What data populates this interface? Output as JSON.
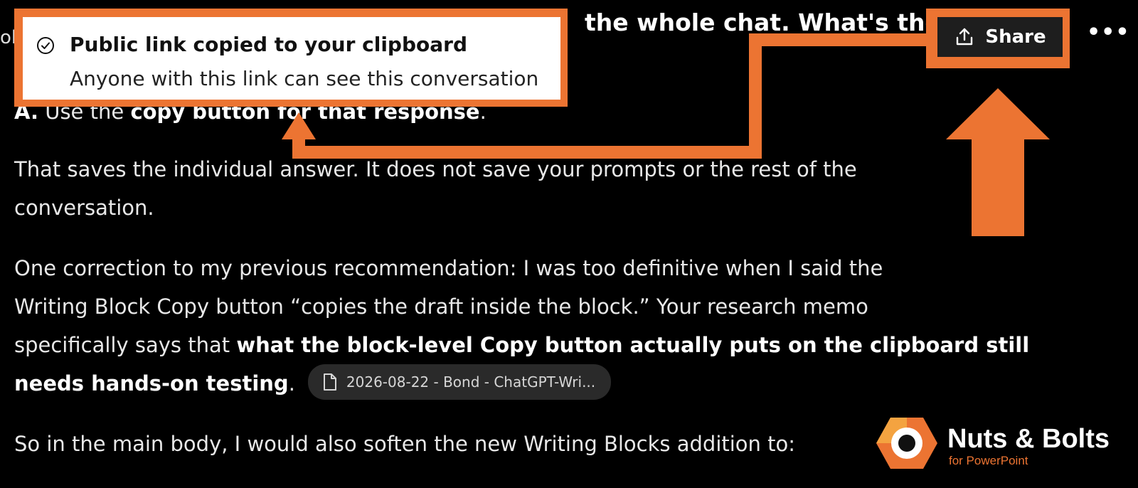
{
  "header": {
    "question_fragment": "the whole chat. What's the",
    "left_fragment": "ol",
    "share_label": "Share",
    "more_label": "•••"
  },
  "toast": {
    "title": "Public link copied to your clipboard",
    "subtitle": "Anyone with this link can see this conversation"
  },
  "answer": {
    "cutoff_prefix": "A.",
    "cutoff_middle": " Use the ",
    "cutoff_bold": "copy button for that response",
    "cutoff_end": ".",
    "p1_line1": "That saves the individual answer. It does not save your prompts or the rest of the",
    "p1_line2": "conversation.",
    "p2_line1": "One correction to my previous recommendation: I was too definitive when I said the",
    "p2_line2": "Writing Block Copy button “copies the draft inside the block.” Your research memo",
    "p2_line3_plain": "specifically says that ",
    "p2_line3_bold": "what the block-level Copy button actually puts on the clipboard still",
    "p2_line4_bold": "needs hands-on testing",
    "p2_line4_end": ".",
    "citation": "2026-08-22 - Bond - ChatGPT-Wri...",
    "p3_line1": "So in the main body, I would also soften the new Writing Blocks addition to:"
  },
  "branding": {
    "name": "Nuts & Bolts",
    "tagline": "for PowerPoint"
  },
  "colors": {
    "accent": "#ec7432",
    "background": "#000000",
    "share_bg": "#1e1e1e",
    "citation_bg": "#2a2a2a"
  }
}
